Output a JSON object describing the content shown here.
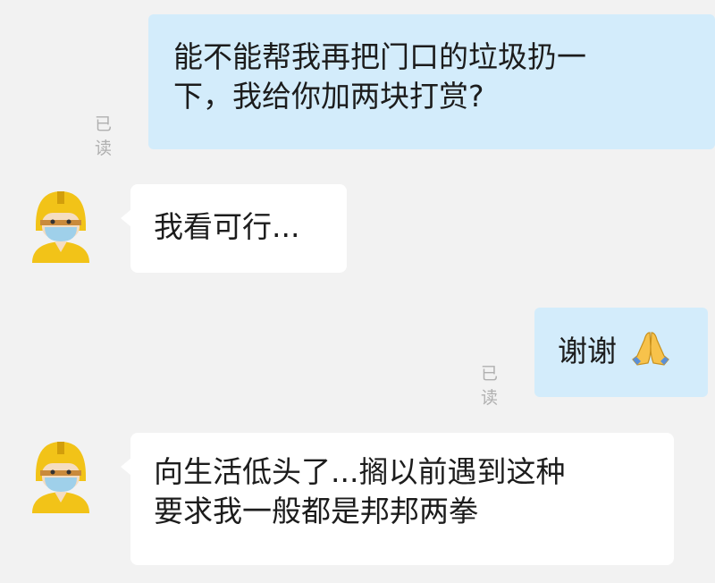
{
  "chat": {
    "messages": [
      {
        "side": "outgoing",
        "text_lines": [
          "能不能帮我再把门口的垃圾扔一",
          "下，我给你加两块打赏?"
        ],
        "status": "已读"
      },
      {
        "side": "incoming",
        "text_lines": [
          "我看可行..."
        ]
      },
      {
        "side": "outgoing",
        "text_lines": [
          "谢谢"
        ],
        "emoji": "folded-hands-icon",
        "status": "已读"
      },
      {
        "side": "incoming",
        "text_lines": [
          "向生活低头了...搁以前遇到这种",
          "要求我一般都是邦邦两拳"
        ]
      }
    ]
  },
  "colors": {
    "background": "#f2f2f2",
    "outgoing_bubble": "#d3ecfb",
    "incoming_bubble": "#ffffff",
    "avatar_helmet": "#f2c318",
    "avatar_mask": "#9fd0ea"
  }
}
